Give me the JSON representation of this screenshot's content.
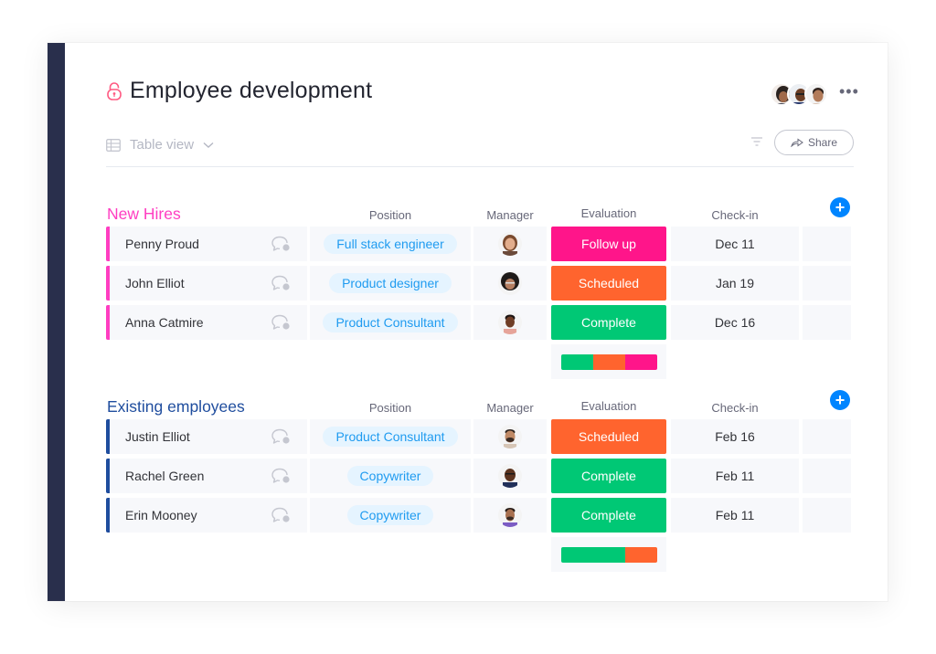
{
  "board": {
    "title": "Employee development",
    "view_label": "Table view",
    "share_label": "Share",
    "icons": {
      "lock": "lock-icon",
      "table": "table-icon",
      "chevron": "chevron-down-icon",
      "filter": "filter-icon",
      "share": "share-arrow-icon",
      "more": "more-horizontal-icon"
    },
    "subscribers_count_shown": 3,
    "more_glyph": "•••"
  },
  "colors": {
    "sidebar": "#292f4c",
    "new_hires": "#ff3dc1",
    "existing": "#1f4d9e",
    "follow_up": "#ff158a",
    "scheduled": "#ff642e",
    "complete": "#00c875",
    "add_button": "#0085ff",
    "pill_bg": "#e5f4ff",
    "pill_text": "#1f9bf0",
    "lock": "#ff5a82"
  },
  "columns": {
    "position": "Position",
    "manager": "Manager",
    "evaluation": "Evaluation",
    "checkin": "Check-in",
    "add_glyph": "+"
  },
  "groups": [
    {
      "title": "New Hires",
      "color_key": "new_hires",
      "rows": [
        {
          "name": "Penny Proud",
          "position": "Full stack engineer",
          "evaluation": "Follow up",
          "status_key": "follow_up",
          "checkin": "Dec 11",
          "manager_avatar": "woman-light-hair"
        },
        {
          "name": "John Elliot",
          "position": "Product designer",
          "evaluation": "Scheduled",
          "status_key": "scheduled",
          "checkin": "Jan 19",
          "manager_avatar": "woman-curly-hair"
        },
        {
          "name": "Anna Catmire",
          "position": "Product Consultant",
          "evaluation": "Complete",
          "status_key": "complete",
          "checkin": "Dec 16",
          "manager_avatar": "man-dark-short-hair"
        }
      ],
      "summary": [
        {
          "status_key": "complete",
          "fraction": 0.3333
        },
        {
          "status_key": "scheduled",
          "fraction": 0.3333
        },
        {
          "status_key": "follow_up",
          "fraction": 0.3334
        }
      ]
    },
    {
      "title": "Existing employees",
      "color_key": "existing",
      "rows": [
        {
          "name": "Justin Elliot",
          "position": "Product Consultant",
          "evaluation": "Scheduled",
          "status_key": "scheduled",
          "checkin": "Feb 16",
          "manager_avatar": "man-beard-smile"
        },
        {
          "name": "Rachel Green",
          "position": "Copywriter",
          "evaluation": "Complete",
          "status_key": "complete",
          "checkin": "Feb 11",
          "manager_avatar": "man-bald-smile"
        },
        {
          "name": "Erin Mooney",
          "position": "Copywriter",
          "evaluation": "Complete",
          "status_key": "complete",
          "checkin": "Feb 11",
          "manager_avatar": "man-purple-shirt"
        }
      ],
      "summary": [
        {
          "status_key": "complete",
          "fraction": 0.6667
        },
        {
          "status_key": "scheduled",
          "fraction": 0.3333
        }
      ]
    }
  ]
}
